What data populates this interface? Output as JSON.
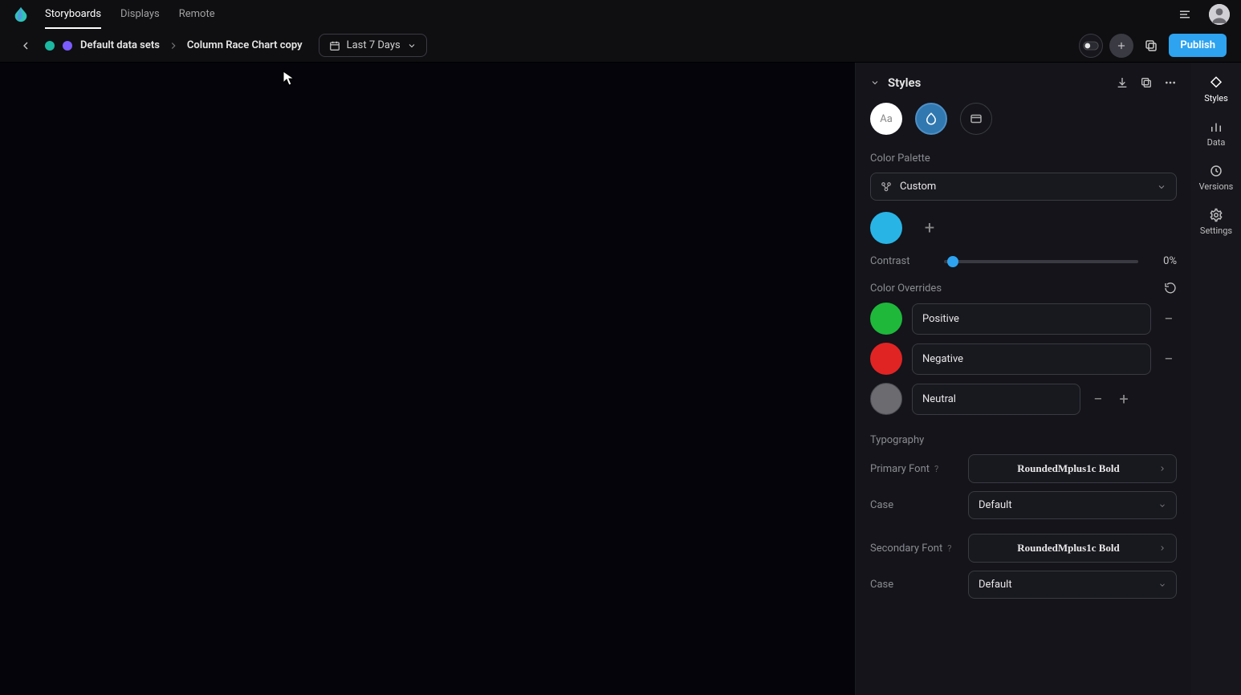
{
  "nav": {
    "tabs": [
      "Storyboards",
      "Displays",
      "Remote"
    ],
    "activeIndex": 0
  },
  "breadcrumb": {
    "items": [
      "Default data sets",
      "Column Race Chart copy"
    ],
    "dateRange": "Last 7 Days",
    "publish": "Publish"
  },
  "sideTabs": {
    "items": [
      "Styles",
      "Data",
      "Versions",
      "Settings"
    ],
    "activeIndex": 0
  },
  "panel": {
    "title": "Styles",
    "colorPalette": {
      "label": "Color Palette",
      "selected": "Custom",
      "swatches": [
        "#29b4e6"
      ]
    },
    "contrast": {
      "label": "Contrast",
      "value": "0%"
    },
    "colorOverrides": {
      "label": "Color Overrides",
      "rows": [
        {
          "color": "#1fb83b",
          "name": "Positive"
        },
        {
          "color": "#e02424",
          "name": "Negative"
        },
        {
          "color": "#6b6b70",
          "name": "Neutral"
        }
      ]
    },
    "typography": {
      "label": "Typography",
      "primaryFontLabel": "Primary Font",
      "primaryFont": "RoundedMplus1c Bold",
      "primaryCaseLabel": "Case",
      "primaryCase": "Default",
      "secondaryFontLabel": "Secondary Font",
      "secondaryFont": "RoundedMplus1c Bold",
      "secondaryCaseLabel": "Case",
      "secondaryCase": "Default"
    }
  }
}
